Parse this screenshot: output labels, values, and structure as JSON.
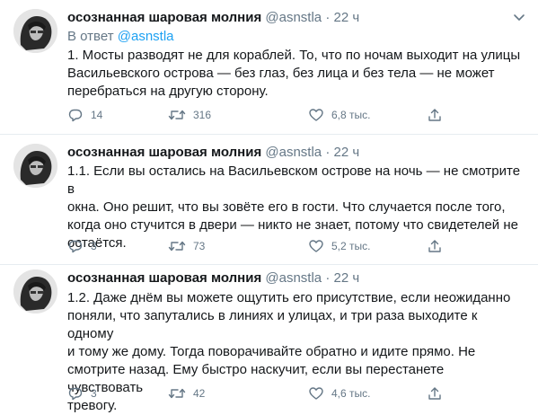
{
  "tweets": [
    {
      "author_name": "осознанная шаровая молния",
      "handle": "@asnstla",
      "separator": "·",
      "time": "22 ч",
      "reply_prefix": "В ответ",
      "reply_mention": "@asnstla",
      "text": "1. Мосты разводят не для кораблей. То, что по ночам выходит на улицы\nВасильевского острова — без глаз, без лица и без тела — не может\nперебраться на другую сторону.",
      "replies": "14",
      "retweets": "316",
      "likes": "6,8 тыс."
    },
    {
      "author_name": "осознанная шаровая молния",
      "handle": "@asnstla",
      "separator": "·",
      "time": "22 ч",
      "text": "1.1. Если вы остались на Васильевском острове на ночь — не смотрите в\nокна. Оно решит, что вы зовёте его в гости. Что случается после того,\nкогда оно стучится в двери — никто не знает, потому что свидетелей не\nостаётся.",
      "replies": "3",
      "retweets": "73",
      "likes": "5,2 тыс."
    },
    {
      "author_name": "осознанная шаровая молния",
      "handle": "@asnstla",
      "separator": "·",
      "time": "22 ч",
      "text": "1.2. Даже днём вы можете ощутить его присутствие, если неожиданно\nпоняли, что запутались в линиях и улицах, и три раза выходите к одному\nи тому же дому. Тогда поворачивайте обратно и идите прямо. Не\nсмотрите назад. Ему быстро наскучит, если вы перестанете чувствовать\nтревогу.",
      "replies": "3",
      "retweets": "42",
      "likes": "4,6 тыс."
    }
  ],
  "icons": {
    "reply": "reply-icon",
    "retweet": "retweet-icon",
    "like": "heart-icon",
    "share": "share-icon",
    "menu": "chevron-down-icon"
  },
  "colors": {
    "text": "#14171a",
    "muted": "#657786",
    "link": "#1da1f2",
    "divider": "#e6ecf0"
  }
}
